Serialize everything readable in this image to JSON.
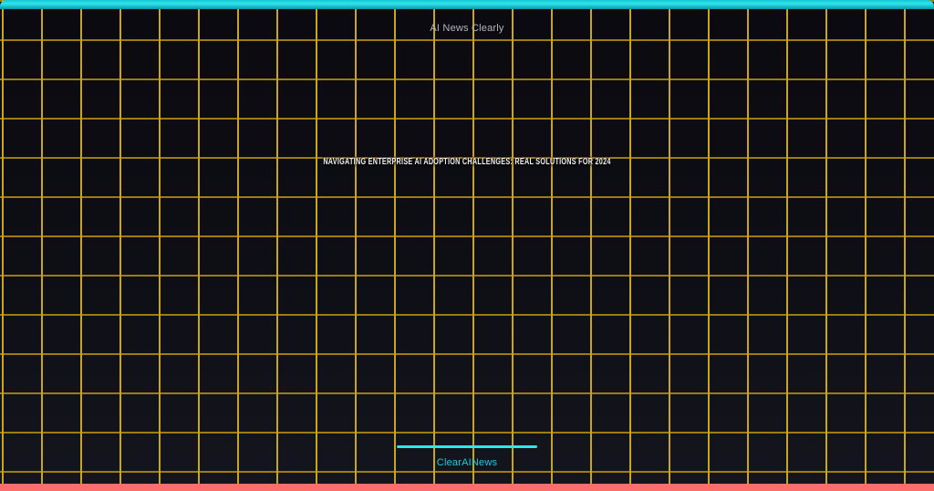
{
  "header": {
    "brand": "AI News Clearly"
  },
  "hero": {
    "title": "NAVIGATING ENTERPRISE AI ADOPTION CHALLENGES: REAL SOLUTIONS FOR 2024"
  },
  "footer": {
    "brand": "ClearAINews"
  },
  "colors": {
    "accent_cyan": "#2ee6ef",
    "accent_coral": "#fb6e6e",
    "grid_line_v": "#c9a41f",
    "grid_line_h": "#9c7d10",
    "bg_top": "#0a0a0f",
    "bg_bottom": "#15151f",
    "title_text": "#f2f2f2",
    "header_text": "#b0b4bd",
    "footer_text": "#1fc9da"
  }
}
